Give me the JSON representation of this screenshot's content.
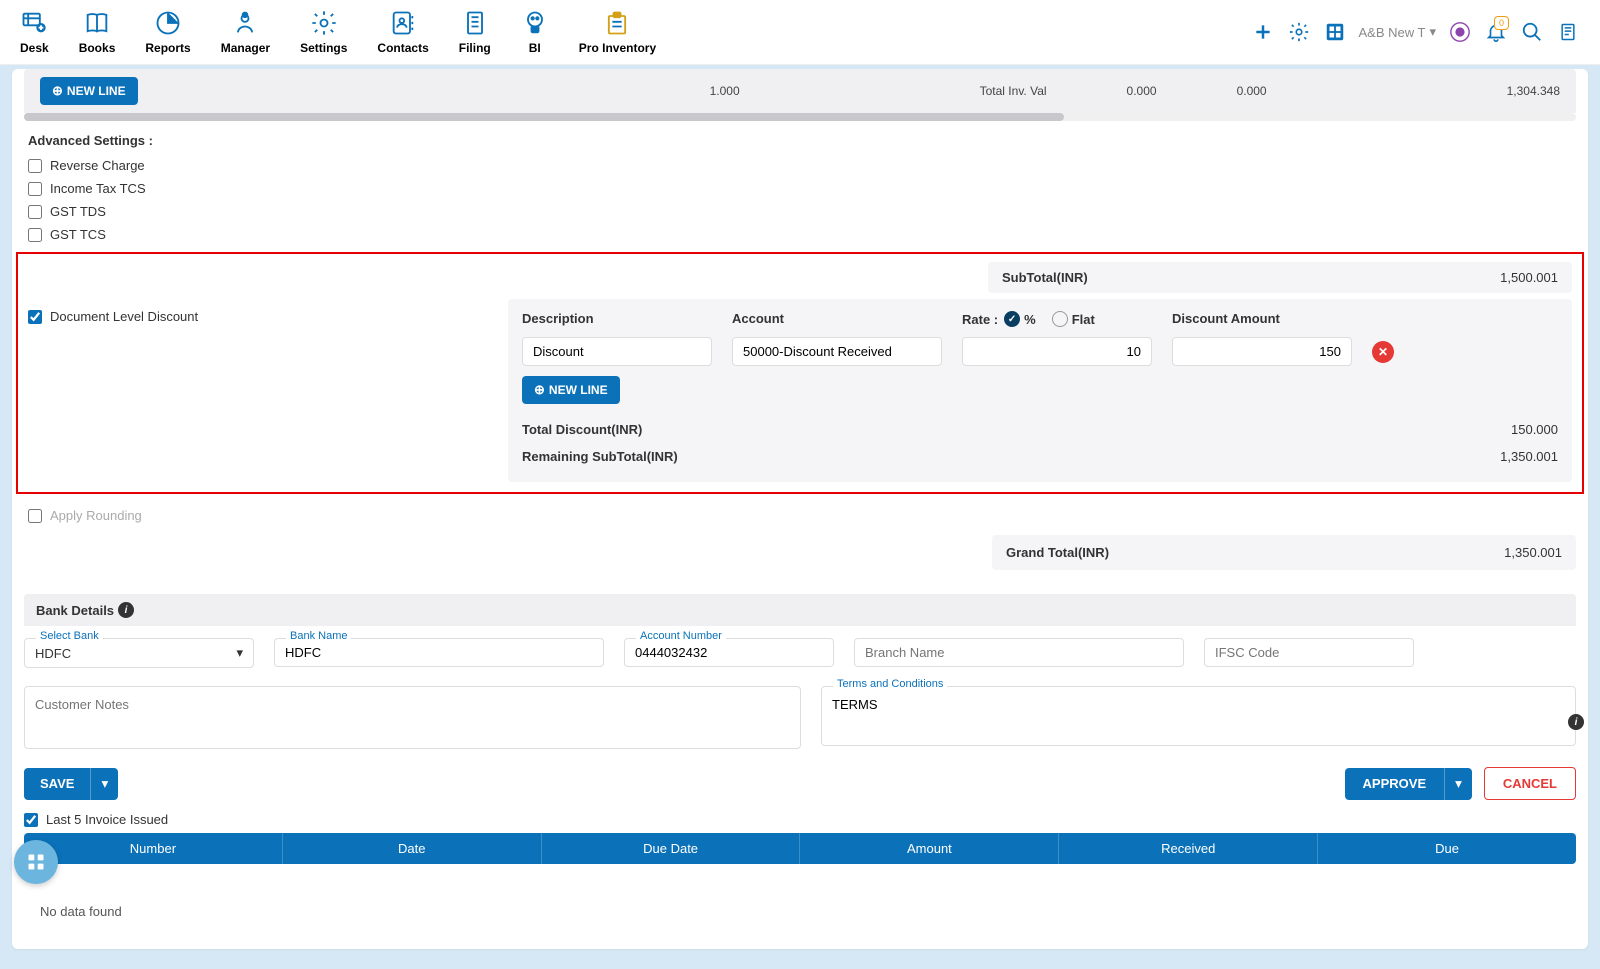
{
  "nav": [
    "Desk",
    "Books",
    "Reports",
    "Manager",
    "Settings",
    "Contacts",
    "Filing",
    "BI",
    "Pro Inventory"
  ],
  "company": "A&B New T",
  "lineItemBar": {
    "newLine": "NEW LINE",
    "qty": "1.000",
    "totalLabel": "Total Inv. Val",
    "v1": "0.000",
    "v2": "0.000",
    "v3": "1,304.348"
  },
  "adv": {
    "title": "Advanced Settings :",
    "opts": [
      "Reverse Charge",
      "Income Tax TCS",
      "GST TDS",
      "GST TCS"
    ]
  },
  "dld": {
    "subtotalLabel": "SubTotal(INR)",
    "subtotalVal": "1,500.001",
    "chk": "Document Level Discount",
    "hdrDesc": "Description",
    "hdrAcc": "Account",
    "hdrRate": "Rate :",
    "optPct": "%",
    "optFlat": "Flat",
    "hdrDamt": "Discount Amount",
    "desc": "Discount",
    "acc": "50000-Discount Received",
    "rate": "10",
    "damt": "150",
    "newLine": "NEW LINE",
    "totDiscLbl": "Total Discount(INR)",
    "totDiscVal": "150.000",
    "remSubLbl": "Remaining SubTotal(INR)",
    "remSubVal": "1,350.001"
  },
  "applyRounding": "Apply Rounding",
  "grandTotal": {
    "lbl": "Grand Total(INR)",
    "val": "1,350.001"
  },
  "bank": {
    "title": "Bank Details",
    "selectLbl": "Select Bank",
    "selectVal": "HDFC",
    "nameLbl": "Bank Name",
    "nameVal": "HDFC",
    "accLbl": "Account Number",
    "accVal": "0444032432",
    "branchPh": "Branch Name",
    "ifscPh": "IFSC Code"
  },
  "notes": {
    "ph": "Customer Notes",
    "termsLbl": "Terms and Conditions",
    "termsVal": "TERMS"
  },
  "actions": {
    "save": "SAVE",
    "approve": "APPROVE",
    "cancel": "CANCEL"
  },
  "last5": {
    "chk": "Last 5 Invoice Issued",
    "cols": [
      "Number",
      "Date",
      "Due Date",
      "Amount",
      "Received",
      "Due"
    ],
    "noData": "No data found"
  },
  "bellCount": "0"
}
